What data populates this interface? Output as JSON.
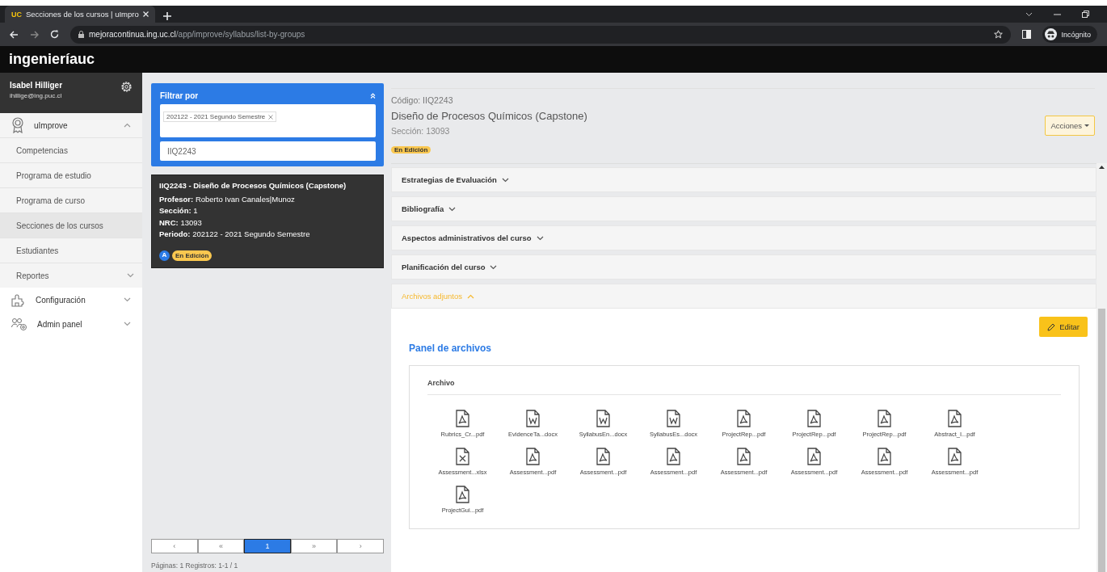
{
  "browser": {
    "tab": {
      "logo": "UC",
      "title": "Secciones de los cursos | uImpro",
      "selected": true
    },
    "url_host": "mejoracontinua.ing.uc.cl",
    "url_path": "/app/improve/syllabus/list-by-groups",
    "profile_label": "Incógnito"
  },
  "header": {
    "brand": "ingenieríauc"
  },
  "user": {
    "name": "Isabel Hilliger",
    "email": "ihillige@ing.puc.cl"
  },
  "sidebar": {
    "items": [
      {
        "label": "uImprove",
        "kind": "award",
        "expanded": true,
        "children": [
          {
            "label": "Competencias",
            "kind": "link",
            "selected": false
          },
          {
            "label": "Programa de estudio",
            "kind": "link",
            "selected": false
          },
          {
            "label": "Programa de curso",
            "kind": "link",
            "selected": false
          },
          {
            "label": "Secciones de los cursos",
            "kind": "link",
            "selected": true
          },
          {
            "label": "Estudiantes",
            "kind": "link",
            "selected": false
          },
          {
            "label": "Reportes",
            "kind": "group",
            "selected": false,
            "expanded": false
          }
        ]
      },
      {
        "label": "Configuración",
        "kind": "puzzle",
        "expanded": false
      },
      {
        "label": "Admin panel",
        "kind": "people",
        "expanded": false
      }
    ]
  },
  "filter": {
    "title": "Filtrar por",
    "expanded": true,
    "tags": [
      "202122 - 2021 Segundo Semestre"
    ],
    "search": "IIQ2243"
  },
  "results": [
    {
      "title": "IIQ2243 - Diseño de Procesos Químicos (Capstone)",
      "fields": [
        {
          "label": "Profesor:",
          "value": "Roberto Ivan Canales|Munoz"
        },
        {
          "label": "Sección:",
          "value": "1"
        },
        {
          "label": "NRC:",
          "value": "13093"
        },
        {
          "label": "Periodo:",
          "value": "202122 - 2021 Segundo Semestre"
        }
      ],
      "avatar": "A",
      "status": "En Edición"
    }
  ],
  "pagination": {
    "buttons": [
      {
        "label": "‹",
        "selected": false
      },
      {
        "label": "«",
        "selected": false
      },
      {
        "label": "1",
        "selected": true
      },
      {
        "label": "»",
        "selected": false
      },
      {
        "label": "›",
        "selected": false
      }
    ],
    "summary": "Páginas: 1 Registros: 1-1 / 1"
  },
  "detail": {
    "code": "Código: IIQ2243",
    "title": "Diseño de Procesos Químicos (Capstone)",
    "section": "Sección: 13093",
    "status": "En Edición",
    "actions": "Acciones",
    "accordion": [
      {
        "title": "Estrategias de Evaluación",
        "expanded": false
      },
      {
        "title": "Bibliografía",
        "expanded": false
      },
      {
        "title": "Aspectos administrativos del curso",
        "expanded": false
      },
      {
        "title": "Planificación del curso",
        "expanded": false
      },
      {
        "title": "Archivos adjuntos",
        "expanded": true
      }
    ],
    "files_panel": {
      "edit": "Editar",
      "title": "Panel de archivos",
      "column": "Archivo",
      "files": [
        {
          "name": "Rubrics_Cr...pdf",
          "kind": "pdf"
        },
        {
          "name": "EvidenceTa...docx",
          "kind": "docx"
        },
        {
          "name": "SyllabusEn...docx",
          "kind": "docx"
        },
        {
          "name": "SyllabusEs...docx",
          "kind": "docx"
        },
        {
          "name": "ProjectRep...pdf",
          "kind": "pdf"
        },
        {
          "name": "ProjectRep...pdf",
          "kind": "pdf"
        },
        {
          "name": "ProjectRep...pdf",
          "kind": "pdf"
        },
        {
          "name": "Abstract_I...pdf",
          "kind": "pdf"
        },
        {
          "name": "Assessment...xlsx",
          "kind": "xlsx"
        },
        {
          "name": "Assessment...pdf",
          "kind": "pdf"
        },
        {
          "name": "Assessment...pdf",
          "kind": "pdf"
        },
        {
          "name": "Assessment...pdf",
          "kind": "pdf"
        },
        {
          "name": "Assessment...pdf",
          "kind": "pdf"
        },
        {
          "name": "Assessment...pdf",
          "kind": "pdf"
        },
        {
          "name": "Assessment...pdf",
          "kind": "pdf"
        },
        {
          "name": "Assessment...pdf",
          "kind": "pdf"
        },
        {
          "name": "ProjectGui...pdf",
          "kind": "pdf"
        }
      ]
    }
  }
}
